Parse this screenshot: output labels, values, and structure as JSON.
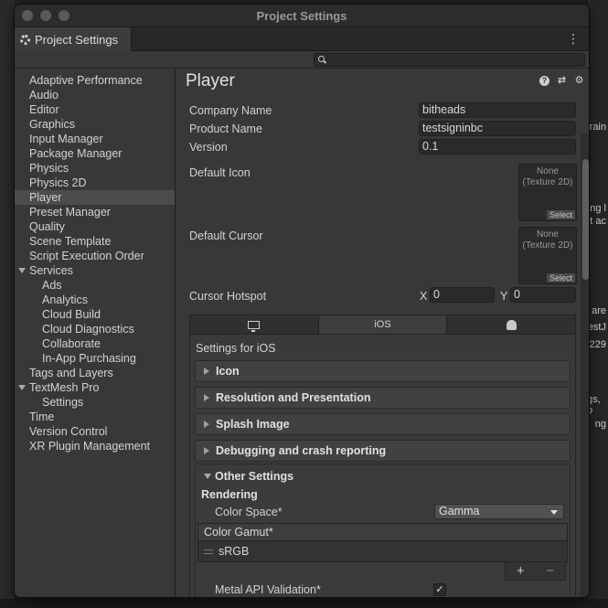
{
  "window": {
    "title": "Project Settings",
    "tab_label": "Project Settings"
  },
  "sidebar": {
    "items": [
      {
        "label": "Adaptive Performance"
      },
      {
        "label": "Audio"
      },
      {
        "label": "Editor"
      },
      {
        "label": "Graphics"
      },
      {
        "label": "Input Manager"
      },
      {
        "label": "Package Manager"
      },
      {
        "label": "Physics"
      },
      {
        "label": "Physics 2D"
      },
      {
        "label": "Player",
        "selected": true
      },
      {
        "label": "Preset Manager"
      },
      {
        "label": "Quality"
      },
      {
        "label": "Scene Template"
      },
      {
        "label": "Script Execution Order"
      },
      {
        "label": "Services",
        "expanded": true
      },
      {
        "label": "Ads"
      },
      {
        "label": "Analytics"
      },
      {
        "label": "Cloud Build"
      },
      {
        "label": "Cloud Diagnostics"
      },
      {
        "label": "Collaborate"
      },
      {
        "label": "In-App Purchasing"
      },
      {
        "label": "Tags and Layers"
      },
      {
        "label": "TextMesh Pro",
        "expanded": true
      },
      {
        "label": "Settings"
      },
      {
        "label": "Time"
      },
      {
        "label": "Version Control"
      },
      {
        "label": "XR Plugin Management"
      }
    ]
  },
  "player": {
    "title": "Player",
    "company_name_label": "Company Name",
    "company_name": "bitheads",
    "product_name_label": "Product Name",
    "product_name": "testsigninbc",
    "version_label": "Version",
    "version": "0.1",
    "default_icon_label": "Default Icon",
    "default_cursor_label": "Default Cursor",
    "texture_none": "None",
    "texture_type": "(Texture 2D)",
    "select_label": "Select",
    "cursor_hotspot_label": "Cursor Hotspot",
    "x_label": "X",
    "x_value": "0",
    "y_label": "Y",
    "y_value": "0"
  },
  "platform": {
    "tabs": [
      {
        "icon": "monitor-icon",
        "label": ""
      },
      {
        "icon": "",
        "label": "iOS",
        "active": true
      },
      {
        "icon": "android-icon",
        "label": ""
      }
    ],
    "settings_for": "Settings for iOS",
    "sections": [
      {
        "label": "Icon"
      },
      {
        "label": "Resolution and Presentation"
      },
      {
        "label": "Splash Image"
      },
      {
        "label": "Debugging and crash reporting"
      }
    ],
    "other_settings": "Other Settings",
    "rendering_label": "Rendering",
    "color_space_label": "Color Space*",
    "color_space_value": "Gamma",
    "color_gamut_label": "Color Gamut*",
    "color_gamut_item": "sRGB",
    "add_label": "+",
    "remove_label": "−",
    "metal_api_label": "Metal API Validation*",
    "metal_api_checked": true,
    "check_glyph": "✓"
  },
  "background_fragments": [
    "rain",
    "ng l",
    "t ac",
    "are",
    "estJ",
    "229",
    "gs, p",
    "ng"
  ]
}
